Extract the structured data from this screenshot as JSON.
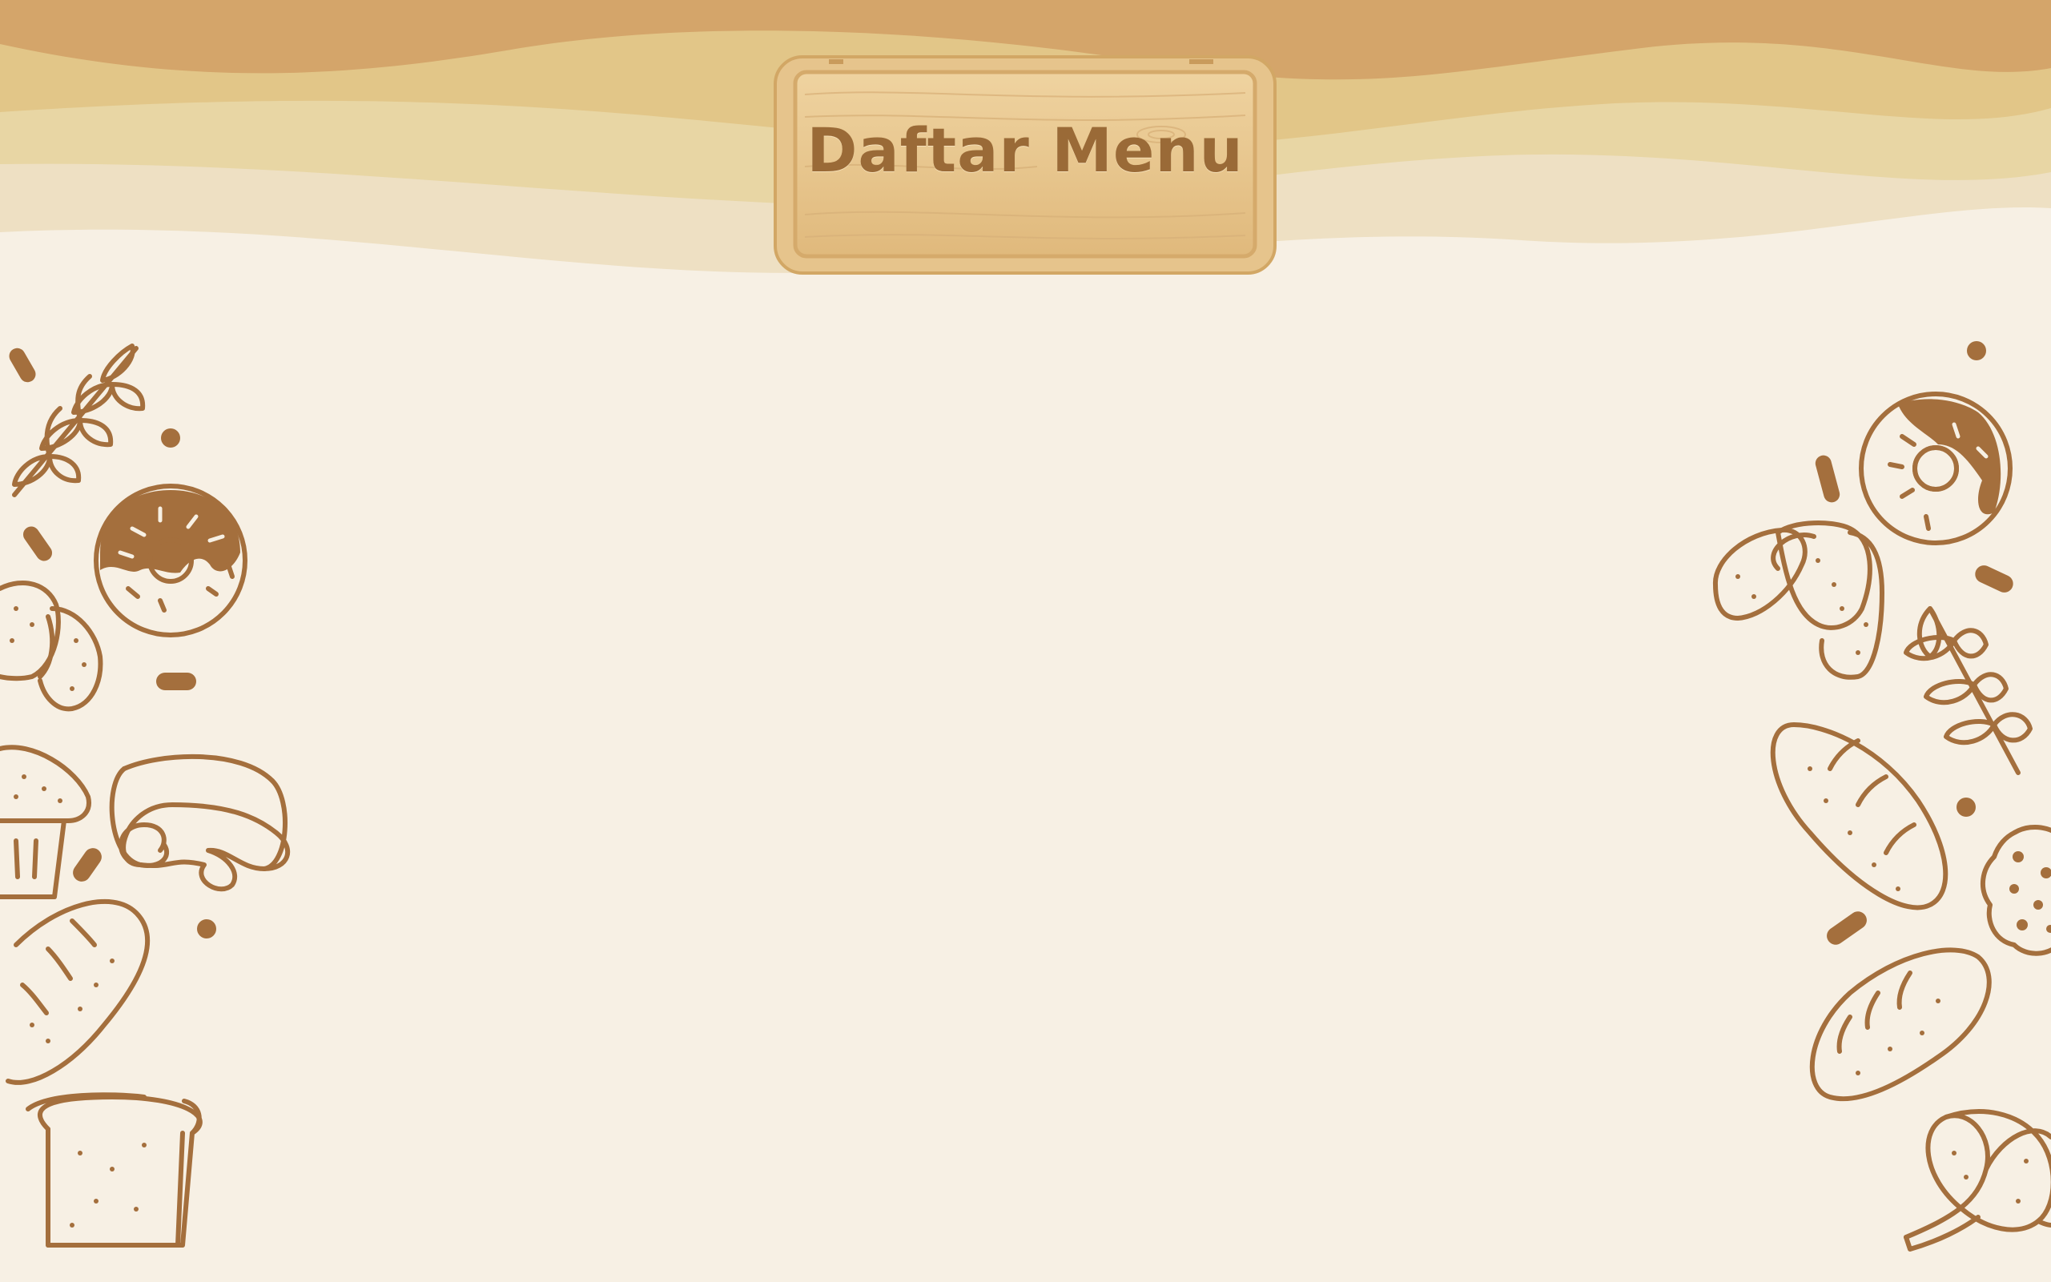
{
  "header": {
    "sign_title": "Daftar Menu"
  },
  "icons": {
    "left": [
      "wheat-icon",
      "donut-icon",
      "croissant-icon",
      "muffin-icon",
      "cinnamon-roll-icon",
      "baguette-icon",
      "bread-slice-icon"
    ],
    "right": [
      "donut-icon",
      "croissant-icon",
      "wheat-icon",
      "baguette-icon",
      "cookie-icon",
      "pretzel-icon"
    ]
  },
  "colors": {
    "background": "#f7f0e4",
    "wave_dark": "#d4a56a",
    "wave_mid": "#e2c688",
    "wave_light": "#e8d6a4",
    "wave_pale": "#eee0c3",
    "doodle": "#a46f3d",
    "sign_wood": "#e8c690",
    "sign_text": "#9a6a37"
  }
}
